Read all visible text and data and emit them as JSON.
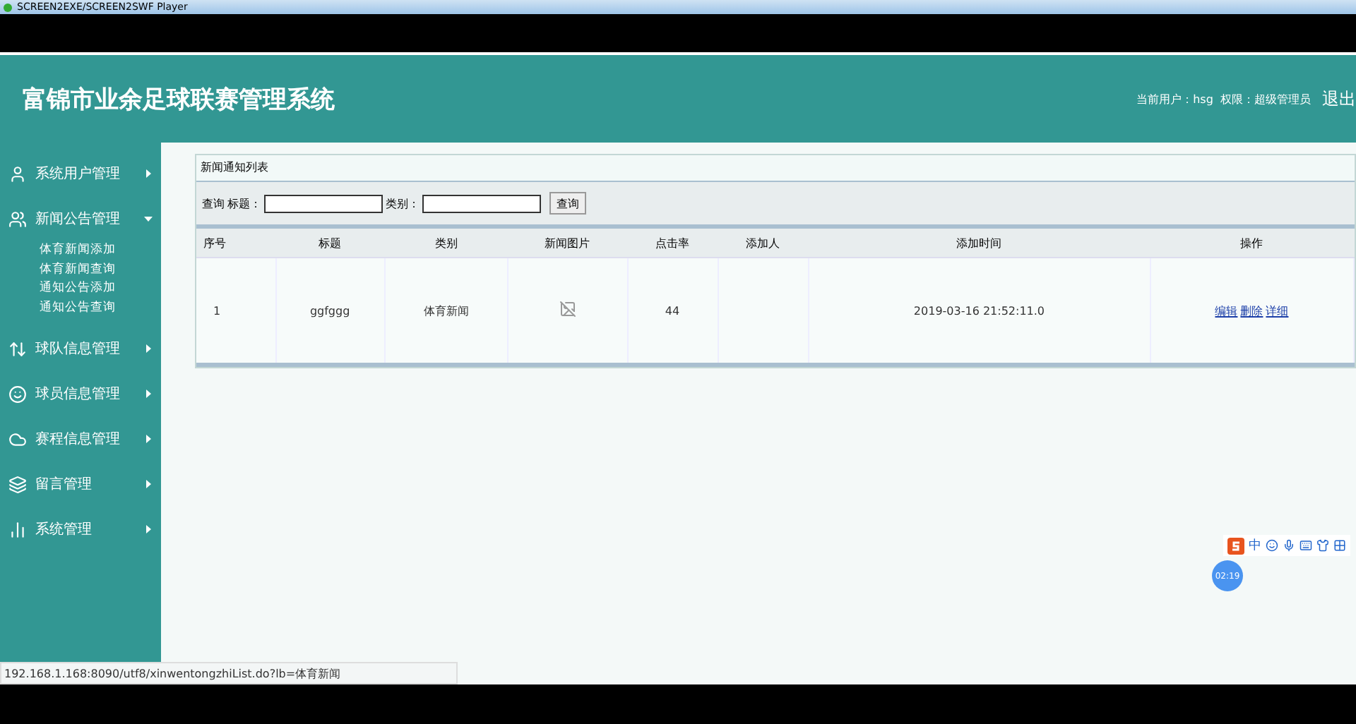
{
  "window": {
    "title": "SCREEN2EXE/SCREEN2SWF Player"
  },
  "header": {
    "title": "富锦市业余足球联赛管理系统",
    "user_info": "当前用户：hsg  权限：超级管理员",
    "logout": "退出"
  },
  "sidebar": {
    "items": [
      {
        "label": "系统用户管理",
        "expanded": false
      },
      {
        "label": "新闻公告管理",
        "expanded": true,
        "children": [
          {
            "label": "体育新闻添加"
          },
          {
            "label": "体育新闻查询"
          },
          {
            "label": "通知公告添加"
          },
          {
            "label": "通知公告查询"
          }
        ]
      },
      {
        "label": "球队信息管理",
        "expanded": false
      },
      {
        "label": "球员信息管理",
        "expanded": false
      },
      {
        "label": "赛程信息管理",
        "expanded": false
      },
      {
        "label": "留言管理",
        "expanded": false
      },
      {
        "label": "系统管理",
        "expanded": false
      }
    ]
  },
  "panel": {
    "title": "新闻通知列表",
    "search": {
      "prefix": "查询",
      "title_label": "标题：",
      "category_label": "类别：",
      "button": "查询"
    }
  },
  "table": {
    "columns": [
      "序号",
      "标题",
      "类别",
      "新闻图片",
      "点击率",
      "添加人",
      "添加时间",
      "操作"
    ],
    "rows": [
      {
        "index": "1",
        "title": "ggfggg",
        "category": "体育新闻",
        "clicks": "44",
        "added_at": "2019-03-16 21:52:11.0",
        "actions": [
          "编辑",
          "删除",
          "详细"
        ]
      }
    ]
  },
  "status_url": "192.168.1.168:8090/utf8/xinwentongzhiList.do?lb=体育新闻",
  "ime_bar": {
    "mode": "中"
  },
  "timer": "02:19"
}
